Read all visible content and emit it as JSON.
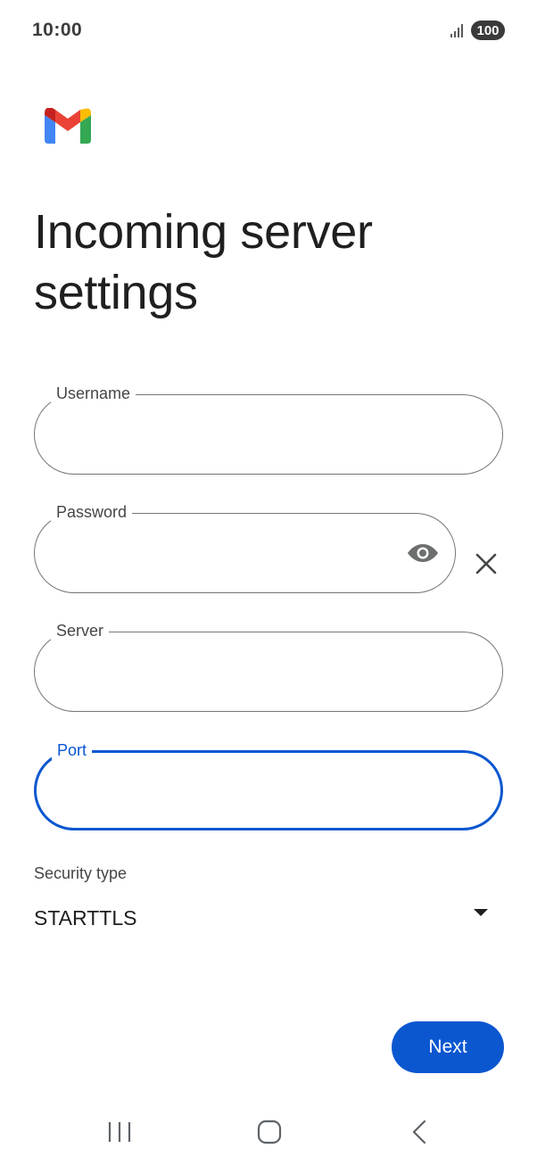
{
  "status_bar": {
    "time": "10:00",
    "battery": "100"
  },
  "title": "Incoming server settings",
  "fields": {
    "username": {
      "label": "Username",
      "value": ""
    },
    "password": {
      "label": "Password",
      "value": ""
    },
    "server": {
      "label": "Server",
      "value": ""
    },
    "port": {
      "label": "Port",
      "value": ""
    }
  },
  "security": {
    "label": "Security type",
    "value": "STARTTLS"
  },
  "next_label": "Next",
  "icons": {
    "logo": "gmail-logo-icon",
    "visibility": "eye-icon",
    "clear": "close-icon",
    "dropdown": "caret-down-icon",
    "nav": [
      "recents-icon",
      "home-icon",
      "back-icon"
    ]
  },
  "colors": {
    "accent": "#0b57d0",
    "outline": "#747775"
  }
}
